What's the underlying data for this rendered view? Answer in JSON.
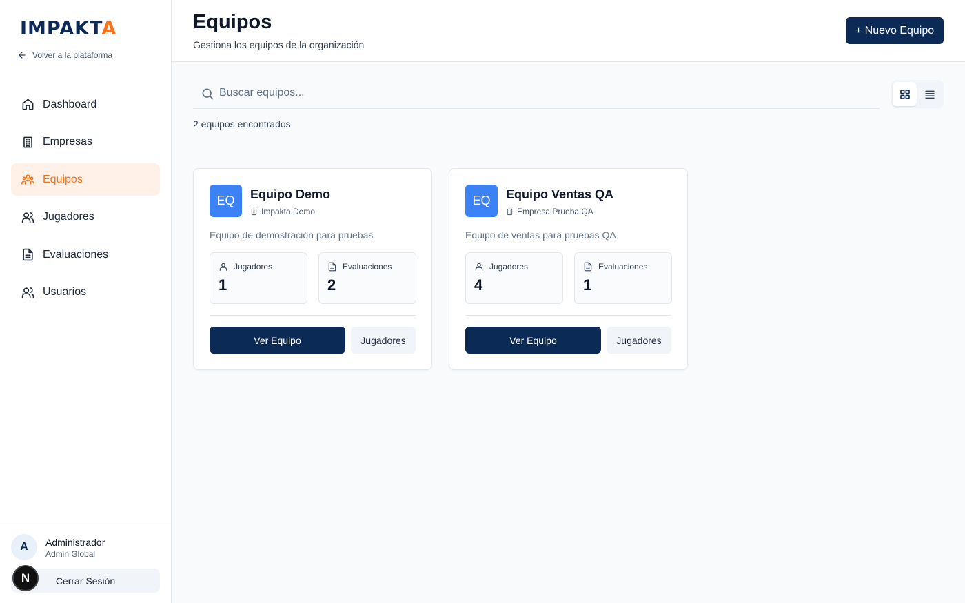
{
  "sidebar": {
    "logo_main": "IMPAKT",
    "logo_accent": "A",
    "back_label": "Volver a la plataforma",
    "items": [
      {
        "label": "Dashboard",
        "icon": "home-icon"
      },
      {
        "label": "Empresas",
        "icon": "building-icon"
      },
      {
        "label": "Equipos",
        "icon": "team-icon",
        "active": true
      },
      {
        "label": "Jugadores",
        "icon": "users-icon"
      },
      {
        "label": "Evaluaciones",
        "icon": "document-icon"
      },
      {
        "label": "Usuarios",
        "icon": "users-icon"
      }
    ],
    "user": {
      "initial": "A",
      "name": "Administrador",
      "role": "Admin Global"
    },
    "logout_label": "Cerrar Sesión",
    "dev_badge": "N"
  },
  "header": {
    "title": "Equipos",
    "subtitle": "Gestiona los equipos de la organización",
    "new_button": "+ Nuevo Equipo"
  },
  "search": {
    "placeholder": "Buscar equipos...",
    "value": ""
  },
  "view_mode": "grid",
  "results_count": "2 equipos encontrados",
  "teams": [
    {
      "badge": "EQ",
      "name": "Equipo Demo",
      "company": "Impakta Demo",
      "description": "Equipo de demostración para pruebas",
      "players_label": "Jugadores",
      "players": "1",
      "evaluations_label": "Evaluaciones",
      "evaluations": "2",
      "view_button": "Ver Equipo",
      "players_button": "Jugadores"
    },
    {
      "badge": "EQ",
      "name": "Equipo Ventas QA",
      "company": "Empresa Prueba QA",
      "description": "Equipo de ventas para pruebas QA",
      "players_label": "Jugadores",
      "players": "4",
      "evaluations_label": "Evaluaciones",
      "evaluations": "1",
      "view_button": "Ver Equipo",
      "players_button": "Jugadores"
    }
  ],
  "colors": {
    "brand_navy": "#0b2a55",
    "accent_orange": "#f97316",
    "badge_blue": "#3b82f6",
    "active_bg": "#fff1e8"
  }
}
